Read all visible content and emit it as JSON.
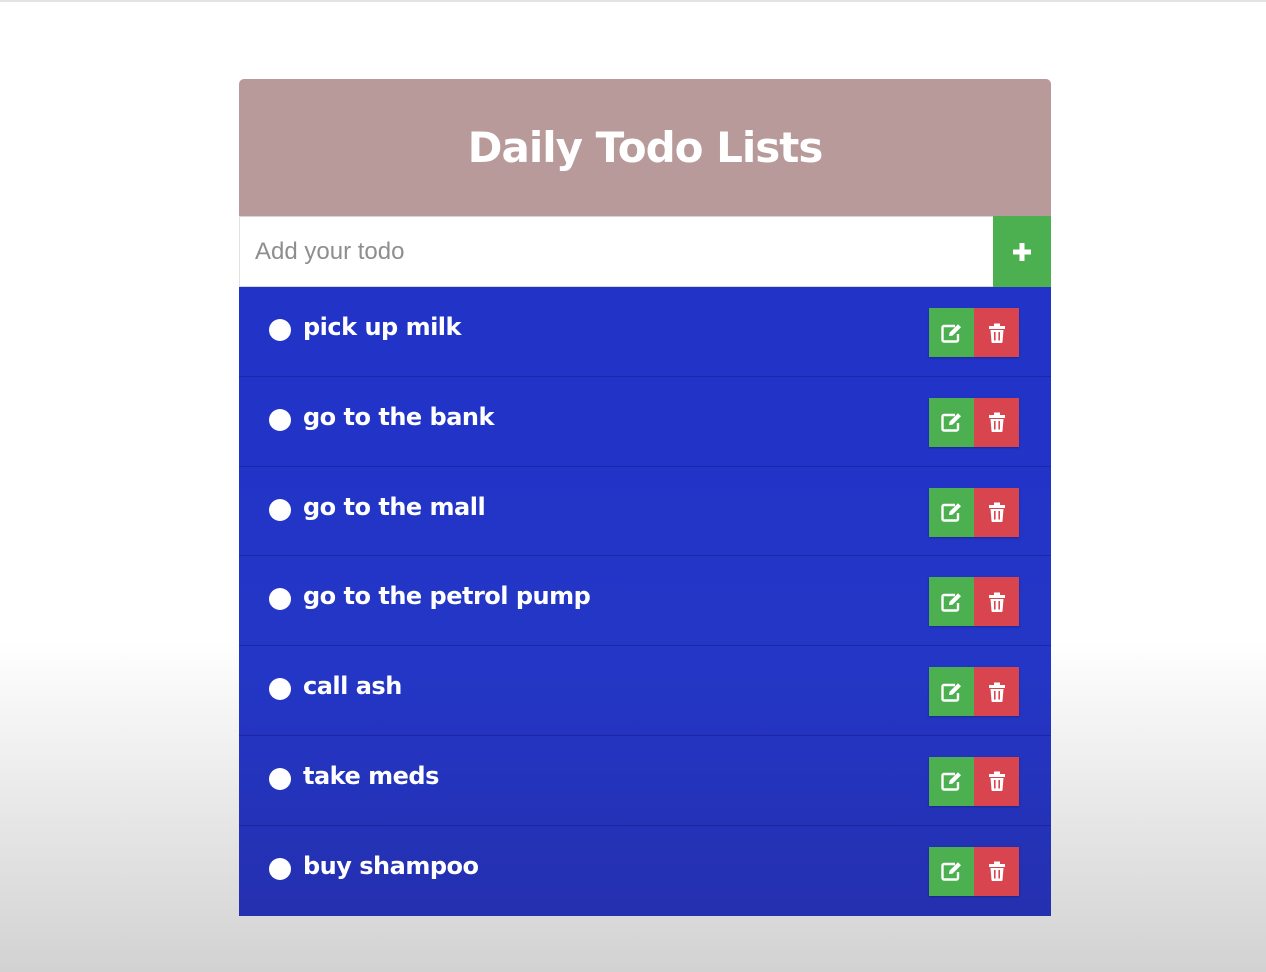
{
  "app": {
    "title": "Daily Todo Lists"
  },
  "input": {
    "placeholder": "Add your todo",
    "value": "",
    "add_icon": "plus-icon"
  },
  "todos": [
    {
      "text": "pick up milk"
    },
    {
      "text": "go to the bank"
    },
    {
      "text": "go to the mall"
    },
    {
      "text": "go to the petrol pump"
    },
    {
      "text": "call ash"
    },
    {
      "text": "take meds"
    },
    {
      "text": "buy shampoo"
    }
  ],
  "icons": {
    "edit": "edit-icon",
    "delete": "trash-icon",
    "bullet": "circle-icon"
  },
  "colors": {
    "header": "#b99a9a",
    "list_background": "#2233c8",
    "add_button": "#4caf50",
    "edit_button": "#4caf50",
    "delete_button": "#d9454e",
    "text": "#ffffff"
  }
}
